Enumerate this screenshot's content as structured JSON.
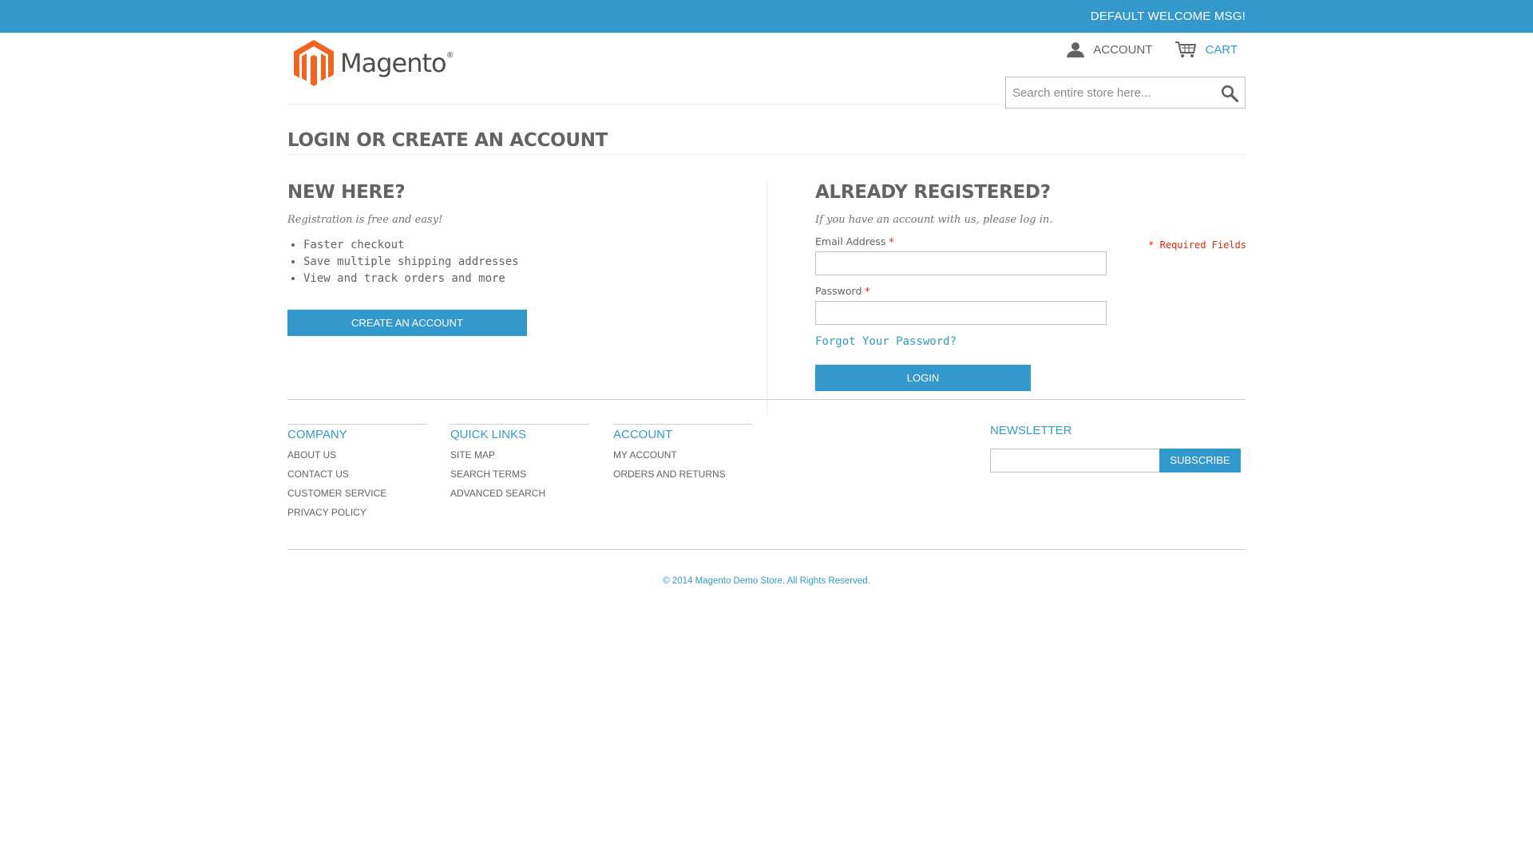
{
  "topbar": {
    "welcome": "DEFAULT WELCOME MSG!"
  },
  "header": {
    "logo_text": "Magento",
    "account_label": "ACCOUNT",
    "cart_label": "CART",
    "search_placeholder": "Search entire store here..."
  },
  "page_title": "LOGIN OR CREATE AN ACCOUNT",
  "new_customer": {
    "title": "NEW HERE?",
    "subtitle": "Registration is free and easy!",
    "benefits": [
      "Faster checkout",
      "Save multiple shipping addresses",
      "View and track orders and more"
    ],
    "button": "CREATE AN ACCOUNT"
  },
  "login": {
    "title": "ALREADY REGISTERED?",
    "subtitle": "If you have an account with us, please log in.",
    "required_note": "* Required Fields",
    "email_label": "Email Address",
    "password_label": "Password",
    "required_star": "*",
    "forgot_link": "Forgot Your Password?",
    "button": "LOGIN"
  },
  "footer": {
    "columns": [
      {
        "title": "COMPANY",
        "links": [
          "ABOUT US",
          "CONTACT US",
          "CUSTOMER SERVICE",
          "PRIVACY POLICY"
        ]
      },
      {
        "title": "QUICK LINKS",
        "links": [
          "SITE MAP",
          "SEARCH TERMS",
          "ADVANCED SEARCH"
        ]
      },
      {
        "title": "ACCOUNT",
        "links": [
          "MY ACCOUNT",
          "ORDERS AND RETURNS"
        ]
      }
    ],
    "newsletter": {
      "title": "NEWSLETTER",
      "button": "SUBSCRIBE"
    },
    "copyright": "© 2014 Magento Demo Store. All Rights Reserved."
  },
  "colors": {
    "accent": "#3399cc",
    "required": "#df280a",
    "logo_orange": "#f26322"
  },
  "icons": {
    "account": "user-icon",
    "cart": "cart-icon",
    "search": "search-icon"
  }
}
